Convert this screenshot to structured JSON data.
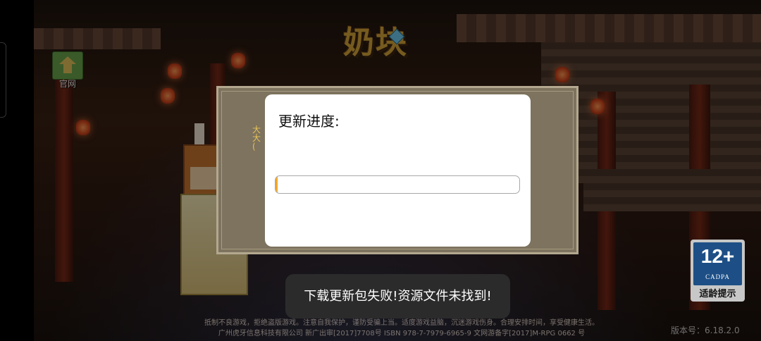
{
  "game": {
    "logo_text": "奶块",
    "home_button_label": "官网"
  },
  "background_panel": {
    "partial_text": "大\n大\n("
  },
  "update_dialog": {
    "title": "更新进度:",
    "progress_fraction": 0.01
  },
  "toast": {
    "message": "下载更新包失败!资源文件未找到!"
  },
  "footer": {
    "health_notice": "抵制不良游戏，拒绝盗版游戏。注意自我保护，谨防受骗上当。适度游戏益脑，沉迷游戏伤身。合理安排时间，享受健康生活。",
    "publisher_info": "广州虎牙信息科技有限公司 新广出审[2017]7708号 ISBN 978-7-7979-6965-9 文网游备字[2017]M-RPG 0662 号",
    "version": "版本号：6.18.2.0"
  },
  "age_rating": {
    "number": "12+",
    "org": "CADPA",
    "caption": "适龄提示"
  },
  "colors": {
    "progress_fill": "#f2a72c",
    "dialog_bg": "#ffffff",
    "toast_bg": "#2d2d2d",
    "badge_blue": "#1d4f86"
  }
}
